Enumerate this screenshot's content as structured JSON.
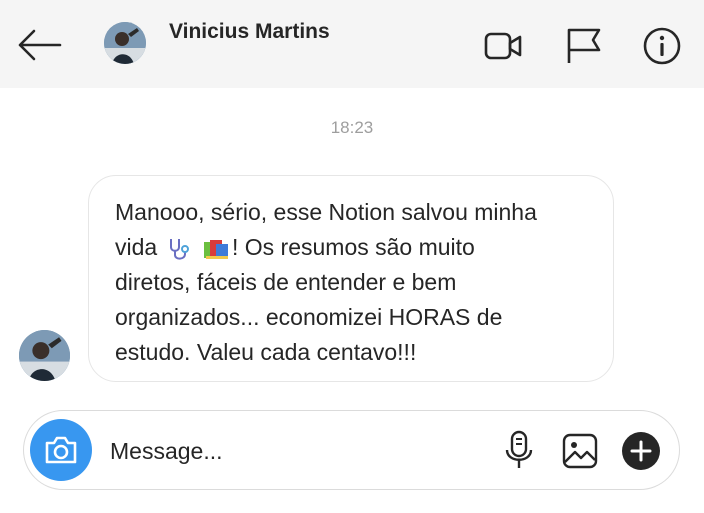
{
  "header": {
    "contact_name": "Vinicius Martins",
    "icons": [
      "back-arrow-icon",
      "video-call-icon",
      "flag-icon",
      "info-icon"
    ]
  },
  "conversation": {
    "timestamp": "18:23",
    "message_lines": [
      "Manooo, sério, esse Notion salvou minha",
      "vida",
      "! Os resumos são muito",
      "diretos, fáceis de entender e bem",
      "organizados... economizei HORAS de",
      "estudo. Valeu cada centavo!!!"
    ],
    "emojis": [
      "stethoscope-emoji",
      "books-emoji"
    ]
  },
  "composer": {
    "placeholder": "Message...",
    "accent_color": "#3897f0",
    "icons": [
      "camera-icon",
      "microphone-icon",
      "gallery-icon",
      "plus-icon"
    ]
  }
}
